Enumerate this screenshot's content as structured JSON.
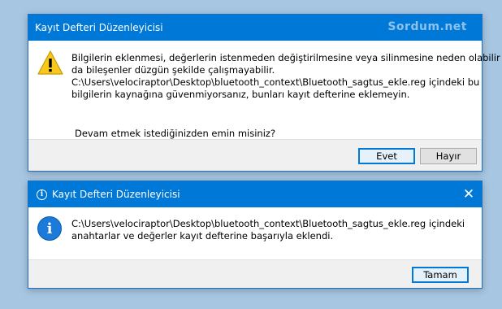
{
  "warning_dialog": {
    "title": "Kayıt Defteri Düzenleyicisi",
    "watermark": "Sordum.net",
    "icon": "warning-icon",
    "message_lines": [
      "Bilgilerin eklenmesi, değerlerin istenmeden değiştirilmesine veya silinmesine neden olabilir ya",
      "da bileşenler düzgün şekilde çalışmayabilir.",
      "C:\\Users\\velociraptor\\Desktop\\bluetooth_context\\Bluetooth_sagtus_ekle.reg içindeki bu",
      "bilgilerin kaynağına güvenmiyorsanız, bunları kayıt defterine eklemeyin."
    ],
    "question": "Devam etmek istediğinizden emin misiniz?",
    "yes_label": "Evet",
    "no_label": "Hayır"
  },
  "info_dialog": {
    "title": "Kayıt Defteri Düzenleyicisi",
    "icon": "info-icon",
    "close_glyph": "✕",
    "message_lines": [
      "C:\\Users\\velociraptor\\Desktop\\bluetooth_context\\Bluetooth_sagtus_ekle.reg içindeki",
      "anahtarlar ve değerler kayıt defterine başarıyla eklendi."
    ],
    "ok_label": "Tamam"
  },
  "colors": {
    "titlebar": "#0078d7",
    "desktop": "#a7c6e1",
    "warning_yellow": "#f8c81d",
    "info_blue": "#1c7ad8"
  }
}
